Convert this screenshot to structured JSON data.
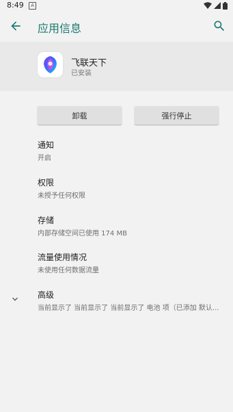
{
  "status_bar": {
    "time": "8:49",
    "notification_icon": "A"
  },
  "app_bar": {
    "title": "应用信息"
  },
  "app": {
    "name": "飞联天下",
    "status": "已安装"
  },
  "buttons": {
    "uninstall": "卸载",
    "force_stop": "强行停止"
  },
  "settings": [
    {
      "title": "通知",
      "subtitle": "开启"
    },
    {
      "title": "权限",
      "subtitle": "未授予任何权限"
    },
    {
      "title": "存储",
      "subtitle": "内部存储空间已使用 174 MB"
    },
    {
      "title": "流量使用情况",
      "subtitle": "未使用任何数据流量"
    },
    {
      "title": "高级",
      "subtitle": "当前显示了 当前显示了 当前显示了 电池 项（已添加 默认..."
    }
  ],
  "colors": {
    "accent": "#1a7a72",
    "background": "#f2f2f2",
    "header_bg": "#e9e9e9",
    "button_bg": "#e0e0e0"
  },
  "icons": [
    "back-arrow-icon",
    "search-icon",
    "wifi-icon",
    "signal-icon",
    "battery-icon",
    "chevron-down-icon",
    "app-logo-icon"
  ]
}
